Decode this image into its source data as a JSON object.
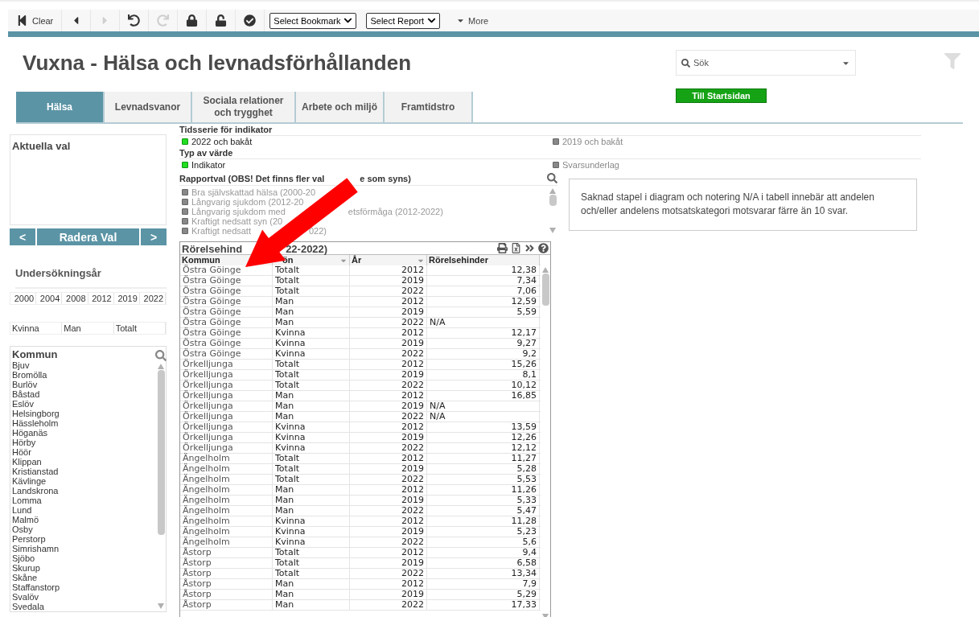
{
  "toolbar": {
    "items": [
      {
        "kind": "clear",
        "label": "Clear",
        "disabled": false
      },
      {
        "kind": "back",
        "disabled": false
      },
      {
        "kind": "forward",
        "disabled": true
      },
      {
        "kind": "undo",
        "disabled": false
      },
      {
        "kind": "redo",
        "disabled": true
      },
      {
        "kind": "lock",
        "disabled": false
      },
      {
        "kind": "unlock",
        "disabled": false
      },
      {
        "kind": "check",
        "disabled": false
      }
    ],
    "dropdowns": [
      "Select Bookmark",
      "Select Report"
    ],
    "more": "More"
  },
  "title": "Vuxna - Hälsa och levnadsförhållanden",
  "search": {
    "placeholder": "Sök"
  },
  "home_button": "Till Startsidan",
  "tabs": [
    {
      "label": "Hälsa",
      "selected": true
    },
    {
      "label": "Levnadsvanor",
      "selected": false
    },
    {
      "label": "Sociala relationer och trygghet",
      "selected": false
    },
    {
      "label": "Arbete och miljö",
      "selected": false
    },
    {
      "label": "Framtidstro",
      "selected": false
    }
  ],
  "current_selections": {
    "title": "Aktuella val",
    "prev": "<",
    "clear": "Radera Val",
    "next": ">"
  },
  "years": {
    "title": "Undersökningsår",
    "items": [
      "2000",
      "2004",
      "2008",
      "2012",
      "2019",
      "2022"
    ]
  },
  "gender": [
    "Kvinna",
    "Man",
    "Totalt"
  ],
  "kommun": {
    "title": "Kommun",
    "items": [
      "Bjuv",
      "Bromölla",
      "Burlöv",
      "Båstad",
      "Eslöv",
      "Helsingborg",
      "Hässleholm",
      "Höganäs",
      "Hörby",
      "Höör",
      "Klippan",
      "Kristianstad",
      "Kävlinge",
      "Landskrona",
      "Lomma",
      "Lund",
      "Malmö",
      "Osby",
      "Perstorp",
      "Simrishamn",
      "Sjöbo",
      "Skurup",
      "Skåne",
      "Staffanstorp",
      "Svalöv",
      "Svedala"
    ]
  },
  "selectors": [
    {
      "title": "Tidsserie för indikator",
      "options": [
        {
          "label": "2022 och bakåt",
          "selected": true
        },
        {
          "label": "2019 och bakåt",
          "selected": false
        }
      ]
    },
    {
      "title": "Typ av värde",
      "options": [
        {
          "label": "Indikator",
          "selected": true
        },
        {
          "label": "Svarsunderlag",
          "selected": false
        }
      ]
    }
  ],
  "report": {
    "title_parts": [
      "Rapportval (OBS! Det finns fler val",
      "e som syns)"
    ],
    "items": [
      [
        "Bra självskattad hälsa (2000-20"
      ],
      [
        "Långvarig sjukdom (2012-20"
      ],
      [
        "Långvarig sjukdom med",
        "etsförmåga (2012-2022)"
      ],
      [
        "Kraftigt nedsatt syn (20"
      ],
      [
        "Kraftigt nedsatt",
        "022)"
      ]
    ]
  },
  "info": "Saknad stapel i diagram och notering N/A i tabell innebär att andelen och/eller andelens motsatskategori motsvarar färre än 10 svar.",
  "table": {
    "title_parts": [
      "Rörelsehind",
      "22-2022)"
    ],
    "columns": [
      {
        "label": "Kommun"
      },
      {
        "label": "ön",
        "filter": true
      },
      {
        "label": "År",
        "filter": true
      },
      {
        "label": "Rörelsehinder"
      }
    ],
    "rows": [
      {
        "kommun": "Östra Göinge",
        "kon": "Totalt",
        "ar": "2012",
        "value": "12,38",
        "missing": false
      },
      {
        "kommun": "Östra Göinge",
        "kon": "Totalt",
        "ar": "2019",
        "value": "7,34",
        "missing": false
      },
      {
        "kommun": "Östra Göinge",
        "kon": "Totalt",
        "ar": "2022",
        "value": "7,06",
        "missing": false
      },
      {
        "kommun": "Östra Göinge",
        "kon": "Man",
        "ar": "2012",
        "value": "12,59",
        "missing": false
      },
      {
        "kommun": "Östra Göinge",
        "kon": "Man",
        "ar": "2019",
        "value": "5,59",
        "missing": false
      },
      {
        "kommun": "Östra Göinge",
        "kon": "Man",
        "ar": "2022",
        "value": "N/A",
        "missing": true
      },
      {
        "kommun": "Östra Göinge",
        "kon": "Kvinna",
        "ar": "2012",
        "value": "12,17",
        "missing": false
      },
      {
        "kommun": "Östra Göinge",
        "kon": "Kvinna",
        "ar": "2019",
        "value": "9,27",
        "missing": false
      },
      {
        "kommun": "Östra Göinge",
        "kon": "Kvinna",
        "ar": "2022",
        "value": "9,2",
        "missing": false
      },
      {
        "kommun": "Örkelljunga",
        "kon": "Totalt",
        "ar": "2012",
        "value": "15,26",
        "missing": false
      },
      {
        "kommun": "Örkelljunga",
        "kon": "Totalt",
        "ar": "2019",
        "value": "8,1",
        "missing": false
      },
      {
        "kommun": "Örkelljunga",
        "kon": "Totalt",
        "ar": "2022",
        "value": "10,12",
        "missing": false
      },
      {
        "kommun": "Örkelljunga",
        "kon": "Man",
        "ar": "2012",
        "value": "16,85",
        "missing": false
      },
      {
        "kommun": "Örkelljunga",
        "kon": "Man",
        "ar": "2019",
        "value": "N/A",
        "missing": true
      },
      {
        "kommun": "Örkelljunga",
        "kon": "Man",
        "ar": "2022",
        "value": "N/A",
        "missing": true
      },
      {
        "kommun": "Örkelljunga",
        "kon": "Kvinna",
        "ar": "2012",
        "value": "13,59",
        "missing": false
      },
      {
        "kommun": "Örkelljunga",
        "kon": "Kvinna",
        "ar": "2019",
        "value": "12,26",
        "missing": false
      },
      {
        "kommun": "Örkelljunga",
        "kon": "Kvinna",
        "ar": "2022",
        "value": "12,12",
        "missing": false
      },
      {
        "kommun": "Ängelholm",
        "kon": "Totalt",
        "ar": "2012",
        "value": "11,27",
        "missing": false
      },
      {
        "kommun": "Ängelholm",
        "kon": "Totalt",
        "ar": "2019",
        "value": "5,28",
        "missing": false
      },
      {
        "kommun": "Ängelholm",
        "kon": "Totalt",
        "ar": "2022",
        "value": "5,53",
        "missing": false
      },
      {
        "kommun": "Ängelholm",
        "kon": "Man",
        "ar": "2012",
        "value": "11,26",
        "missing": false
      },
      {
        "kommun": "Ängelholm",
        "kon": "Man",
        "ar": "2019",
        "value": "5,33",
        "missing": false
      },
      {
        "kommun": "Ängelholm",
        "kon": "Man",
        "ar": "2022",
        "value": "5,47",
        "missing": false
      },
      {
        "kommun": "Ängelholm",
        "kon": "Kvinna",
        "ar": "2012",
        "value": "11,28",
        "missing": false
      },
      {
        "kommun": "Ängelholm",
        "kon": "Kvinna",
        "ar": "2019",
        "value": "5,23",
        "missing": false
      },
      {
        "kommun": "Ängelholm",
        "kon": "Kvinna",
        "ar": "2022",
        "value": "5,6",
        "missing": false
      },
      {
        "kommun": "Åstorp",
        "kon": "Totalt",
        "ar": "2012",
        "value": "9,4",
        "missing": false
      },
      {
        "kommun": "Åstorp",
        "kon": "Totalt",
        "ar": "2019",
        "value": "6,58",
        "missing": false
      },
      {
        "kommun": "Åstorp",
        "kon": "Totalt",
        "ar": "2022",
        "value": "13,34",
        "missing": false
      },
      {
        "kommun": "Åstorp",
        "kon": "Man",
        "ar": "2012",
        "value": "7,9",
        "missing": false
      },
      {
        "kommun": "Åstorp",
        "kon": "Man",
        "ar": "2019",
        "value": "5,29",
        "missing": false
      },
      {
        "kommun": "Åstorp",
        "kon": "Man",
        "ar": "2022",
        "value": "17,33",
        "missing": false
      }
    ]
  }
}
